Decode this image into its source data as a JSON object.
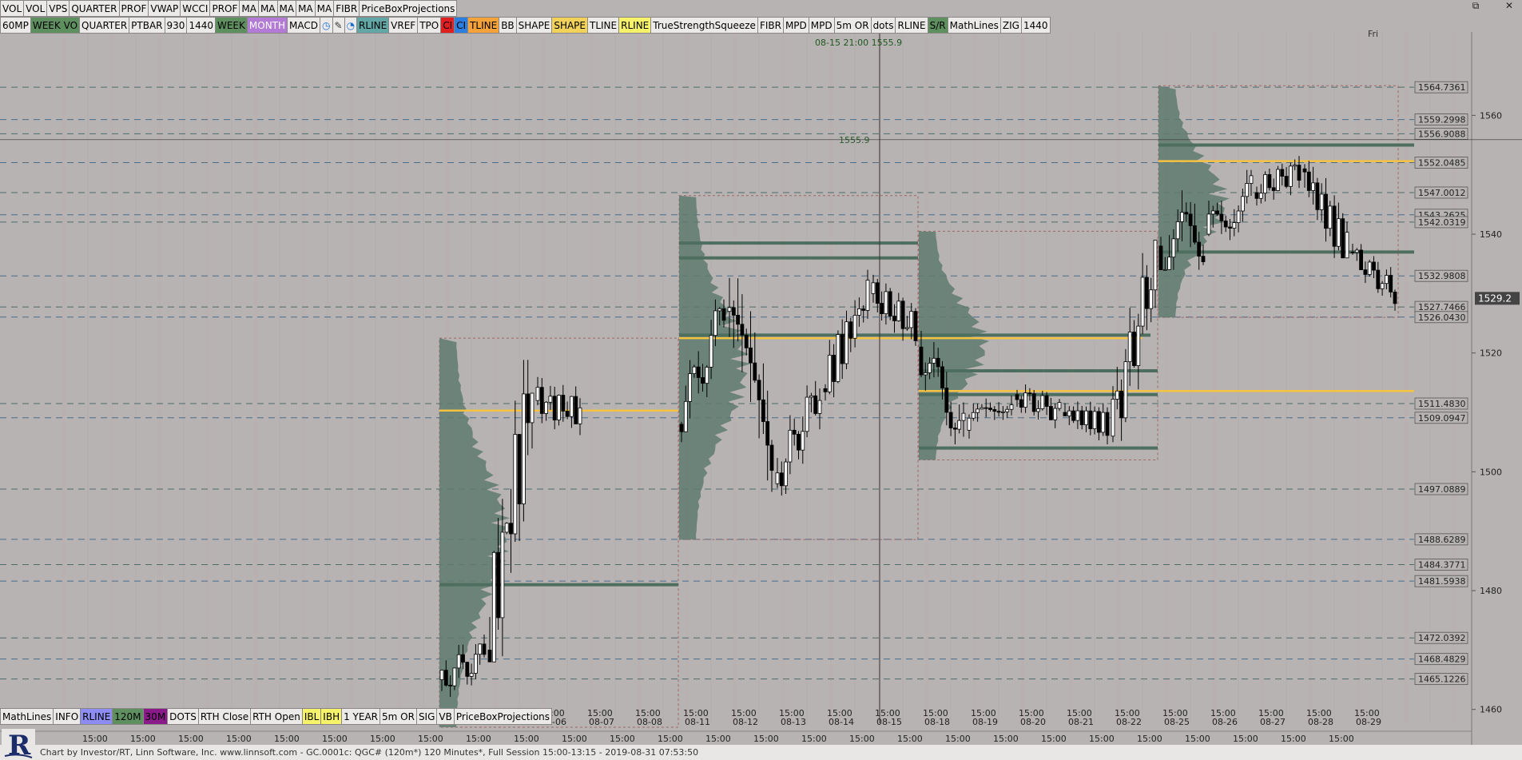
{
  "window": {
    "controls": [
      "⧉",
      "✕"
    ]
  },
  "toolbar_top": [
    {
      "label": "VOL",
      "bg": "#ece9e9",
      "fg": "#000"
    },
    {
      "label": "VOL",
      "bg": "#ece9e9",
      "fg": "#000"
    },
    {
      "label": "VPS",
      "bg": "#ece9e9",
      "fg": "#000"
    },
    {
      "label": "QUARTER",
      "bg": "#ece9e9",
      "fg": "#000"
    },
    {
      "label": "PROF",
      "bg": "#ece9e9",
      "fg": "#000"
    },
    {
      "label": "VWAP",
      "bg": "#ece9e9",
      "fg": "#000"
    },
    {
      "label": "WCCI",
      "bg": "#ece9e9",
      "fg": "#000"
    },
    {
      "label": "PROF",
      "bg": "#ece9e9",
      "fg": "#000"
    },
    {
      "label": "MA",
      "bg": "#ece9e9",
      "fg": "#000"
    },
    {
      "label": "MA",
      "bg": "#ece9e9",
      "fg": "#000"
    },
    {
      "label": "MA",
      "bg": "#ece9e9",
      "fg": "#000"
    },
    {
      "label": "MA",
      "bg": "#ece9e9",
      "fg": "#000"
    },
    {
      "label": "MA",
      "bg": "#ece9e9",
      "fg": "#000"
    },
    {
      "label": "FIBR",
      "bg": "#ece9e9",
      "fg": "#000"
    },
    {
      "label": "PriceBoxProjections",
      "bg": "#ece9e9",
      "fg": "#000"
    }
  ],
  "toolbar_second": [
    {
      "label": "60MP",
      "bg": "#ece9e9",
      "fg": "#000"
    },
    {
      "label": "WEEK VO",
      "bg": "#5e8f5e",
      "fg": "#000"
    },
    {
      "label": "QUARTER",
      "bg": "#ece9e9",
      "fg": "#000"
    },
    {
      "label": "PTBAR",
      "bg": "#ece9e9",
      "fg": "#000"
    },
    {
      "label": "930",
      "bg": "#ece9e9",
      "fg": "#000"
    },
    {
      "label": "1440",
      "bg": "#ece9e9",
      "fg": "#000"
    },
    {
      "label": "WEEK",
      "bg": "#5e8f5e",
      "fg": "#000"
    },
    {
      "label": "MONTH",
      "bg": "#b37bd6",
      "fg": "#fff"
    },
    {
      "label": "MACD",
      "bg": "#ece9e9",
      "fg": "#000"
    },
    {
      "label": "◷",
      "bg": "#ece9e9",
      "fg": "#1a6fd0"
    },
    {
      "label": "✎",
      "bg": "#ece9e9",
      "fg": "#333"
    },
    {
      "label": "◔",
      "bg": "#ece9e9",
      "fg": "#1a6fd0"
    },
    {
      "label": "RLINE",
      "bg": "#63a6a6",
      "fg": "#000"
    },
    {
      "label": "VREF",
      "bg": "#ece9e9",
      "fg": "#000"
    },
    {
      "label": "TPO",
      "bg": "#ece9e9",
      "fg": "#000"
    },
    {
      "label": "CI",
      "bg": "#e02020",
      "fg": "#000"
    },
    {
      "label": "CI",
      "bg": "#2a7fe0",
      "fg": "#000"
    },
    {
      "label": "TLINE",
      "bg": "#f5a23a",
      "fg": "#000"
    },
    {
      "label": "BB",
      "bg": "#ece9e9",
      "fg": "#000"
    },
    {
      "label": "SHAPE",
      "bg": "#ece9e9",
      "fg": "#000"
    },
    {
      "label": "SHAPE",
      "bg": "#f3d25a",
      "fg": "#000"
    },
    {
      "label": "TLINE",
      "bg": "#ece9e9",
      "fg": "#000"
    },
    {
      "label": "RLINE",
      "bg": "#f6f36a",
      "fg": "#000"
    },
    {
      "label": "TrueStrengthSqueeze",
      "bg": "#ece9e9",
      "fg": "#000"
    },
    {
      "label": "FIBR",
      "bg": "#ece9e9",
      "fg": "#000"
    },
    {
      "label": "MPD",
      "bg": "#ece9e9",
      "fg": "#000"
    },
    {
      "label": "MPD",
      "bg": "#ece9e9",
      "fg": "#000"
    },
    {
      "label": "5m OR",
      "bg": "#ece9e9",
      "fg": "#000"
    },
    {
      "label": "dots",
      "bg": "#ece9e9",
      "fg": "#000"
    },
    {
      "label": "RLINE",
      "bg": "#ece9e9",
      "fg": "#000"
    },
    {
      "label": "S/R",
      "bg": "#5e8f5e",
      "fg": "#000"
    },
    {
      "label": "MathLines",
      "bg": "#ece9e9",
      "fg": "#000"
    },
    {
      "label": "ZIG",
      "bg": "#ece9e9",
      "fg": "#000"
    },
    {
      "label": "1440",
      "bg": "#ece9e9",
      "fg": "#000"
    }
  ],
  "toolbar_bottom": [
    {
      "label": "MathLines",
      "bg": "#ece9e9",
      "fg": "#000"
    },
    {
      "label": "INFO",
      "bg": "#ece9e9",
      "fg": "#000"
    },
    {
      "label": "RLINE",
      "bg": "#8c8cf2",
      "fg": "#000"
    },
    {
      "label": "120M",
      "bg": "#5e8f5e",
      "fg": "#000"
    },
    {
      "label": "30M",
      "bg": "#8a1a8a",
      "fg": "#000"
    },
    {
      "label": "DOTS",
      "bg": "#ece9e9",
      "fg": "#000"
    },
    {
      "label": "RTH Close",
      "bg": "#ece9e9",
      "fg": "#000"
    },
    {
      "label": "RTH Open",
      "bg": "#ece9e9",
      "fg": "#000"
    },
    {
      "label": "IBL",
      "bg": "#f6f36a",
      "fg": "#000"
    },
    {
      "label": "IBH",
      "bg": "#f6f36a",
      "fg": "#000"
    },
    {
      "label": "1 YEAR",
      "bg": "#ece9e9",
      "fg": "#000"
    },
    {
      "label": "5m OR",
      "bg": "#ece9e9",
      "fg": "#000"
    },
    {
      "label": "SIG",
      "bg": "#ece9e9",
      "fg": "#000"
    },
    {
      "label": "VB",
      "bg": "#ece9e9",
      "fg": "#000"
    },
    {
      "label": "PriceBoxProjections",
      "bg": "#ece9e9",
      "fg": "#000"
    }
  ],
  "footer": {
    "text": "Chart by Investor/RT, Linn Software, Inc. www.linnsoft.com - GC.0001c: QGC# (120m*) 120 Minutes*, Full Session 15:00-13:15 - 2019-08-31 07:53:50"
  },
  "chart_data": {
    "type": "candlestick",
    "symbol": "GC.0001c: QGC#",
    "interval": "120 Minutes*",
    "ylim": [
      1457,
      1577
    ],
    "y_ticks": [
      1460,
      1480,
      1500,
      1520,
      1540,
      1560
    ],
    "crosshair": {
      "label": "08-15 21:00",
      "price": "1555.9",
      "price_text_on_chart": "1555.9"
    },
    "day_label_top": "Fri",
    "current_price": "1529.2",
    "dates": [
      "08-06",
      "08-07",
      "08-08",
      "08-11",
      "08-12",
      "08-13",
      "08-14",
      "08-15",
      "08-18",
      "08-19",
      "08-20",
      "08-21",
      "08-22",
      "08-25",
      "08-26",
      "08-27",
      "08-28",
      "08-29"
    ],
    "time_label": "15:00",
    "level_labels": [
      "1564.7361",
      "1559.2998",
      "1556.9088",
      "1552.0485",
      "1547.0012",
      "1543.2625",
      "1542.0319",
      "1532.9808",
      "1527.7466",
      "1526.0430",
      "1511.4830",
      "1509.0947",
      "1497.0889",
      "1488.6289",
      "1484.3771",
      "1481.5938",
      "1472.0392",
      "1468.4829",
      "1465.1226"
    ],
    "levels": [
      1564.7361,
      1559.2998,
      1556.9088,
      1552.0485,
      1547.0012,
      1543.2625,
      1542.0319,
      1532.9808,
      1527.7466,
      1526.043,
      1511.483,
      1509.0947,
      1497.0889,
      1488.6289,
      1484.3771,
      1481.5938,
      1472.0392,
      1468.4829,
      1465.1226
    ],
    "poc_lines": [
      {
        "price": 1522.5,
        "color": "#f5c242"
      },
      {
        "price": 1510.3,
        "color": "#f5c242"
      },
      {
        "price": 1513.6,
        "color": "#f5c242"
      },
      {
        "price": 1552.3,
        "color": "#f5c242"
      }
    ],
    "sr_lines": [
      1536,
      1523,
      1513,
      1517,
      1504,
      1555,
      1537,
      1538.5,
      1481
    ],
    "session_boxes": [
      {
        "name": "week-1",
        "start": "08-06",
        "end": "08-08",
        "top": 1522.5,
        "bottom": 1457
      },
      {
        "name": "week-2",
        "start": "08-11",
        "end": "08-15",
        "top": 1546.5,
        "bottom": 1488.6
      },
      {
        "name": "week-3",
        "start": "08-18",
        "end": "08-22",
        "top": 1540.5,
        "bottom": 1502
      },
      {
        "name": "week-4",
        "start": "08-25",
        "end": "08-29",
        "top": 1565,
        "bottom": 1526
      }
    ],
    "weekly_closes": [
      {
        "date": "08-06",
        "open": 1465,
        "high": 1473,
        "low": 1457,
        "close": 1469
      },
      {
        "date": "08-07",
        "open": 1470,
        "high": 1523,
        "low": 1468,
        "close": 1515
      },
      {
        "date": "08-08",
        "open": 1512,
        "high": 1521,
        "low": 1505,
        "close": 1510
      },
      {
        "date": "08-11",
        "open": 1508,
        "high": 1529,
        "low": 1505,
        "close": 1527
      },
      {
        "date": "08-12",
        "open": 1527,
        "high": 1543,
        "low": 1488,
        "close": 1496
      },
      {
        "date": "08-13",
        "open": 1498,
        "high": 1518,
        "low": 1496,
        "close": 1514
      },
      {
        "date": "08-14",
        "open": 1514,
        "high": 1534,
        "low": 1512,
        "close": 1530
      },
      {
        "date": "08-15",
        "open": 1530,
        "high": 1537,
        "low": 1520,
        "close": 1524
      },
      {
        "date": "08-18",
        "open": 1521,
        "high": 1526,
        "low": 1503,
        "close": 1507
      },
      {
        "date": "08-19",
        "open": 1507,
        "high": 1517,
        "low": 1504,
        "close": 1513
      },
      {
        "date": "08-20",
        "open": 1513,
        "high": 1518,
        "low": 1506,
        "close": 1510
      },
      {
        "date": "08-21",
        "open": 1510,
        "high": 1515,
        "low": 1502,
        "close": 1508
      },
      {
        "date": "08-22",
        "open": 1506,
        "high": 1539,
        "low": 1505,
        "close": 1536
      },
      {
        "date": "08-25",
        "open": 1538,
        "high": 1565,
        "low": 1534,
        "close": 1540
      },
      {
        "date": "08-26",
        "open": 1540,
        "high": 1554,
        "low": 1535,
        "close": 1547
      },
      {
        "date": "08-27",
        "open": 1547,
        "high": 1557,
        "low": 1544,
        "close": 1551
      },
      {
        "date": "08-28",
        "open": 1551,
        "high": 1559,
        "low": 1536,
        "close": 1537
      },
      {
        "date": "08-29",
        "open": 1537,
        "high": 1539,
        "low": 1527,
        "close": 1530
      }
    ]
  }
}
